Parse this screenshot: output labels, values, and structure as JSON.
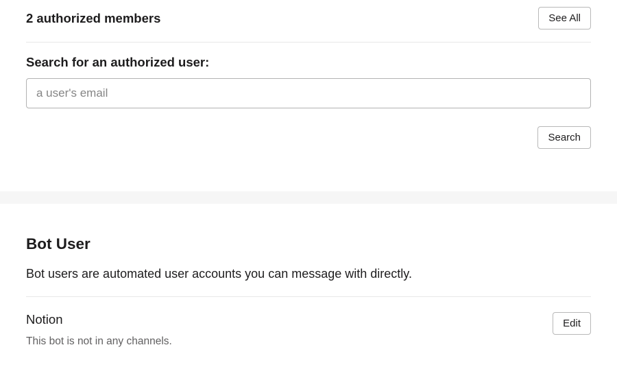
{
  "members": {
    "header": "2 authorized members",
    "see_all_label": "See All",
    "search_label": "Search for an authorized user:",
    "search_placeholder": "a user's email",
    "search_button_label": "Search"
  },
  "bot": {
    "title": "Bot User",
    "description": "Bot users are automated user accounts you can message with directly.",
    "name": "Notion",
    "status": "This bot is not in any channels.",
    "edit_label": "Edit"
  }
}
